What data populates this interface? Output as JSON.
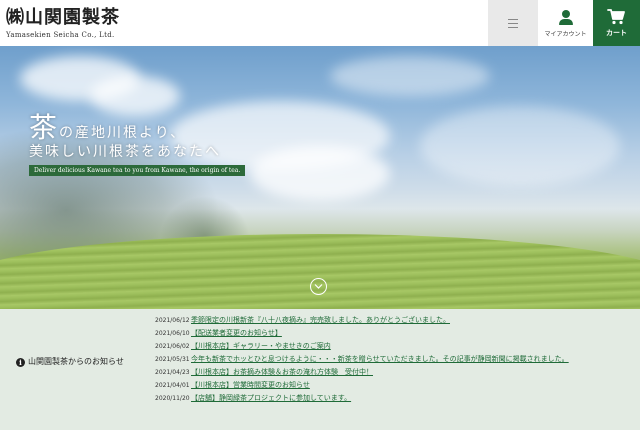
{
  "header": {
    "logo_main": "㈱山関園製茶",
    "logo_sub": "Yamasekien Seicha Co., Ltd.",
    "menu_icon": "hamburger-icon",
    "account_label": "マイアカウント",
    "cart_label": "カート",
    "accent_color": "#1f6b38"
  },
  "hero": {
    "line1_big": "茶",
    "line1_rest": "の産地川根より、",
    "line2": "美味しい川根茶をあなたへ",
    "tagline": "Deliver delicious Kawane tea to you from Kawane, the origin of tea.",
    "scroll_icon": "chevron-down-icon"
  },
  "news": {
    "heading": "山関園製茶からのお知らせ",
    "items": [
      {
        "date": "2021/06/12",
        "title": "季節限定の川根新茶『八十八夜摘み』完売致しました。ありがとうございました。"
      },
      {
        "date": "2021/06/10",
        "title": "【配送業者変更のお知らせ】"
      },
      {
        "date": "2021/06/02",
        "title": "【川根本店】ギャラリー・やませきのご案内"
      },
      {
        "date": "2021/05/31",
        "title": "今年も新茶でホッとひと息つけるように・・・新茶を贈らせていただきました。その記事が静岡新聞に掲載されました。"
      },
      {
        "date": "2021/04/23",
        "title": "【川根本店】お茶摘み体験＆お茶の淹れ方体験　受付中！"
      },
      {
        "date": "2021/04/01",
        "title": "【川根本店】営業時間変更のお知らせ"
      },
      {
        "date": "2020/11/20",
        "title": "【店舗】静岡緑茶プロジェクトに参加しています。"
      }
    ]
  }
}
